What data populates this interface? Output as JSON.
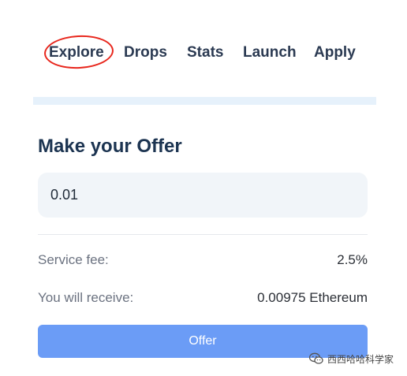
{
  "nav": {
    "items": [
      {
        "label": "Explore"
      },
      {
        "label": "Drops"
      },
      {
        "label": "Stats"
      },
      {
        "label": "Launch"
      },
      {
        "label": "Apply"
      }
    ],
    "highlighted": "Explore",
    "highlight_color": "#e8261c"
  },
  "offer": {
    "title": "Make your Offer",
    "amount_value": "0.01",
    "service_fee_label": "Service fee:",
    "service_fee_value": "2.5%",
    "receive_label": "You will receive:",
    "receive_value": "0.00975 Ethereum",
    "button_label": "Offer",
    "button_color": "#6b9cf6"
  },
  "watermark": {
    "text": "西西哈哈科学家",
    "icon": "wechat-logo-icon"
  }
}
